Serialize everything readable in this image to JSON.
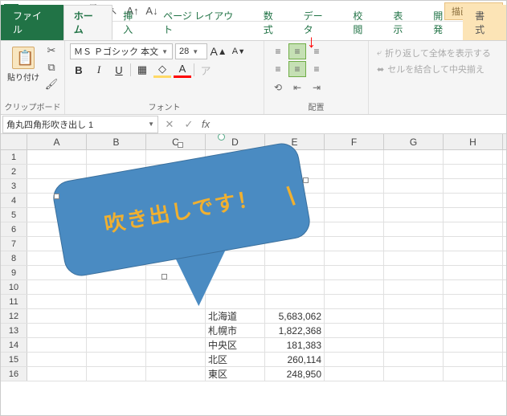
{
  "qat": {
    "excel": "X"
  },
  "drawtool_tab": "描画ツール",
  "tabs": {
    "file": "ファイル",
    "home": "ホーム",
    "insert": "挿入",
    "pagelayout": "ページ レイアウト",
    "formulas": "数式",
    "data": "データ",
    "review": "校閲",
    "view": "表示",
    "developer": "開発",
    "format": "書式"
  },
  "ribbon": {
    "clipboard": {
      "label": "クリップボード",
      "paste": "貼り付け"
    },
    "font": {
      "label": "フォント",
      "name": "ＭＳ Ｐゴシック 本文",
      "size": "28",
      "inc": "A",
      "dec": "A",
      "bold": "B",
      "italic": "I",
      "underline": "U"
    },
    "align": {
      "label": "配置",
      "wrap": "折り返して全体を表示する",
      "merge": "セルを結合して中央揃え"
    }
  },
  "namebox": "角丸四角形吹き出し 1",
  "fx": "fx",
  "columns": [
    "A",
    "B",
    "C",
    "D",
    "E",
    "F",
    "G",
    "H"
  ],
  "rownums": [
    1,
    2,
    3,
    4,
    5,
    6,
    7,
    8,
    9,
    10,
    11,
    12,
    13,
    14,
    15,
    16
  ],
  "cells": {
    "12": {
      "D": "北海道",
      "E": "5,683,062"
    },
    "13": {
      "D": "札幌市",
      "E": "1,822,368"
    },
    "14": {
      "D": "中央区",
      "E": "181,383"
    },
    "15": {
      "D": "北区",
      "E": "260,114"
    },
    "16": {
      "D": "東区",
      "E": "248,950"
    }
  },
  "callout_text": "吹き出しです！"
}
